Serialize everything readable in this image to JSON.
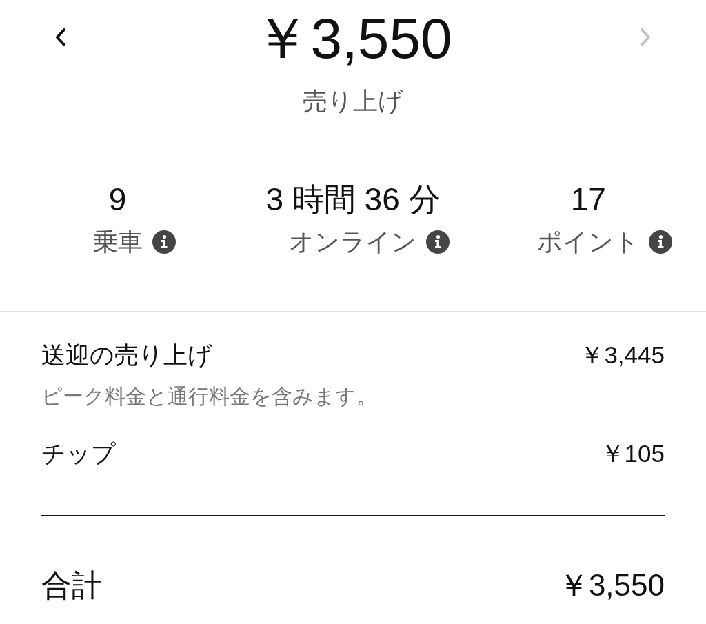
{
  "header": {
    "prev": {
      "disabled": false
    },
    "next": {
      "disabled": true
    },
    "amount": "￥3,550",
    "label": "売り上げ"
  },
  "stats": [
    {
      "value": "9",
      "label": "乗車"
    },
    {
      "value": "3 時間 36 分",
      "label": "オンライン"
    },
    {
      "value": "17",
      "label": "ポイント"
    }
  ],
  "breakdown": [
    {
      "label": "送迎の売り上げ",
      "amount": "￥3,445",
      "note": "ピーク料金と通行料金を含みます。"
    },
    {
      "label": "チップ",
      "amount": "￥105"
    }
  ],
  "total": {
    "label": "合計",
    "amount": "￥3,550"
  }
}
